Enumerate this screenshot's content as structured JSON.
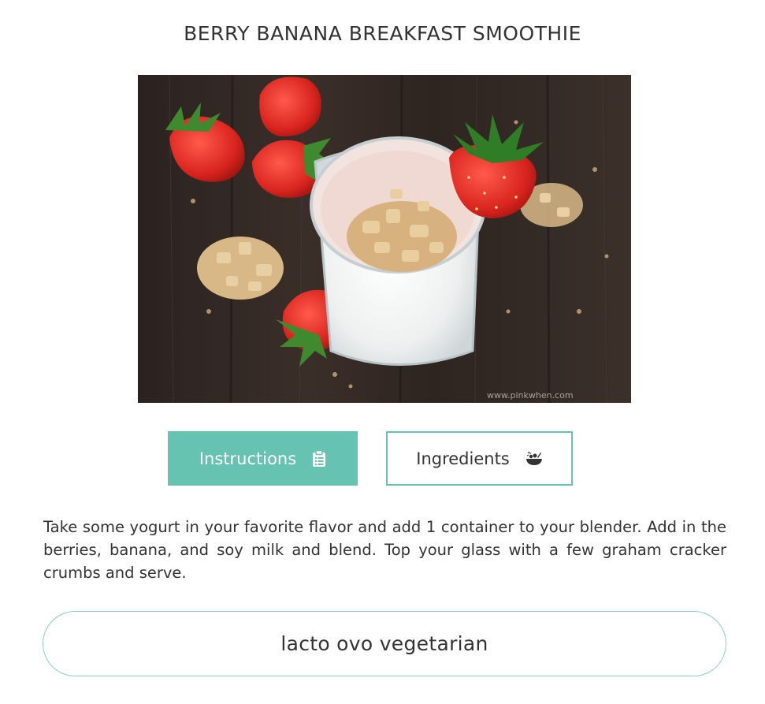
{
  "recipe": {
    "title": "BERRY BANANA BREAKFAST SMOOTHIE",
    "image": {
      "watermark": "www.pinkwhen.com"
    },
    "tabs": [
      {
        "label": "Instructions",
        "icon": "clipboard-icon",
        "active": true
      },
      {
        "label": "Ingredients",
        "icon": "salad-bowl-icon",
        "active": false
      }
    ],
    "instructions": "Take some yogurt in your favorite flavor and add 1 container to your blender. Add in the berries, banana, and soy milk and blend. Top your glass with a few graham cracker crumbs and serve.",
    "diet": "lacto ovo vegetarian"
  },
  "colors": {
    "accent": "#66c2b1",
    "text": "#333333",
    "background": "#ffffff"
  }
}
